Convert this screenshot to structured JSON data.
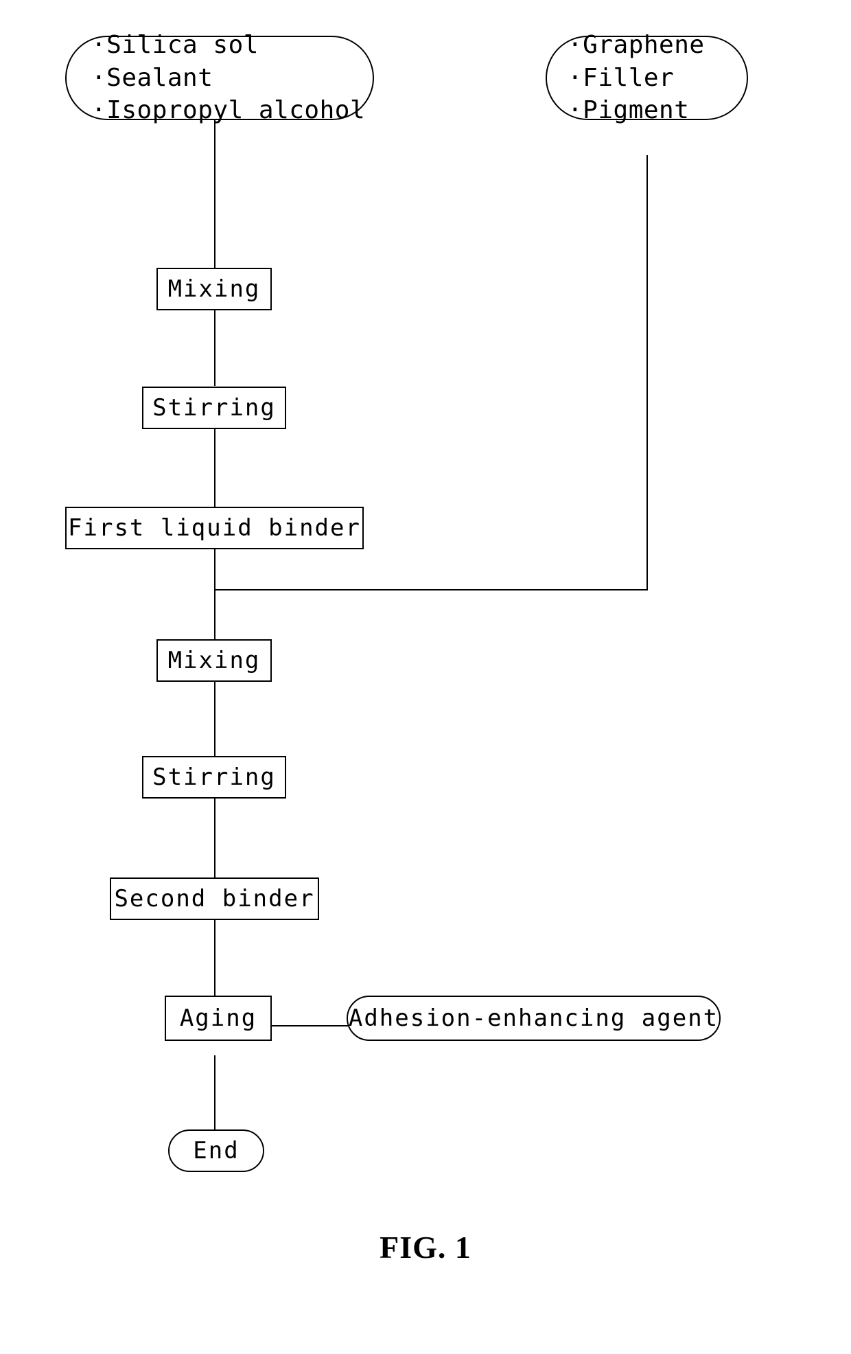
{
  "figure": {
    "caption": "FIG. 1",
    "title": "Binder manufacturing process flowchart"
  },
  "nodes": {
    "inputs_left": {
      "shape": "stadium",
      "lines": [
        "·Silica sol",
        "·Sealant",
        "·Isopropyl alcohol"
      ],
      "text": "·Silica sol\n·Sealant\n·Isopropyl alcohol"
    },
    "inputs_right": {
      "shape": "stadium",
      "lines": [
        "·Graphene",
        "·Filler",
        "·Pigment"
      ],
      "text": "·Graphene\n·Filler\n·Pigment"
    },
    "mixing_1": {
      "shape": "rect",
      "label": "Mixing"
    },
    "stirring_1": {
      "shape": "rect",
      "label": "Stirring"
    },
    "first_liquid_binder": {
      "shape": "rect",
      "label": "First liquid binder"
    },
    "mixing_2": {
      "shape": "rect",
      "label": "Mixing"
    },
    "stirring_2": {
      "shape": "rect",
      "label": "Stirring"
    },
    "second_binder": {
      "shape": "rect",
      "label": "Second binder"
    },
    "aging": {
      "shape": "rect",
      "label": "Aging"
    },
    "adhesion_agent": {
      "shape": "stadium",
      "label": "Adhesion-enhancing agent"
    },
    "end": {
      "shape": "stadium",
      "label": "End"
    }
  },
  "colors": {
    "stroke": "#000000",
    "fill": "#ffffff",
    "text": "#000000"
  }
}
